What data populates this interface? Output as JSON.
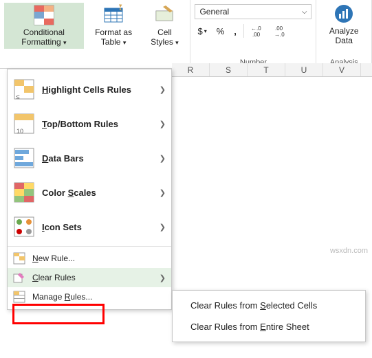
{
  "ribbon": {
    "conditional_formatting": "Conditional Formatting",
    "format_as_table": "Format as Table",
    "cell_styles": "Cell Styles",
    "number_group_label": "Number",
    "number_format_selected": "General",
    "currency": "$",
    "percent": "%",
    "comma": ",",
    "increase_decimal": "←.0\n.00",
    "decrease_decimal": ".00\n→.0",
    "analysis_group_label": "Analysis",
    "analyze_data": "Analyze Data"
  },
  "columns": [
    "R",
    "S",
    "T",
    "U",
    "V"
  ],
  "menu": {
    "highlight_cells": "Highlight Cells Rules",
    "top_bottom": "Top/Bottom Rules",
    "data_bars": "Data Bars",
    "color_scales": "Color Scales",
    "icon_sets": "Icon Sets",
    "new_rule": "New Rule...",
    "clear_rules": "Clear Rules",
    "manage_rules": "Manage Rules..."
  },
  "submenu": {
    "selected_cells": "Clear Rules from Selected Cells",
    "entire_sheet": "Clear Rules from Entire Sheet"
  },
  "watermark": "wsxdn.com"
}
